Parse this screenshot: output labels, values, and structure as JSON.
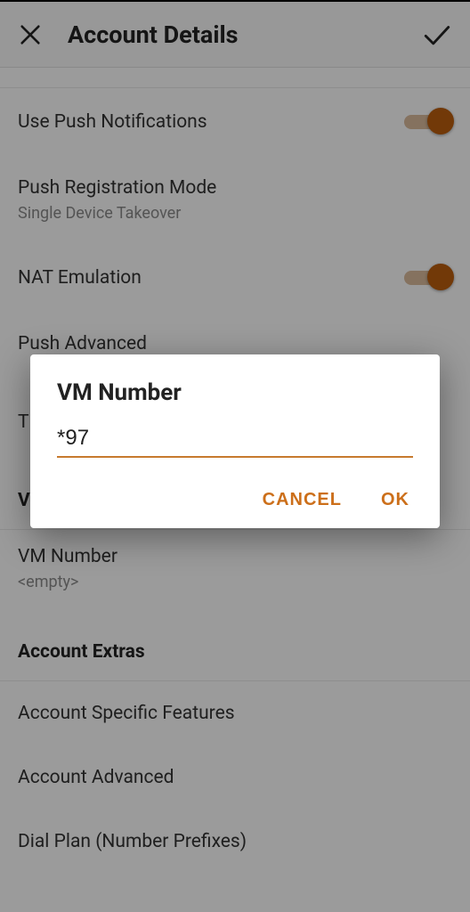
{
  "header": {
    "title": "Account Details"
  },
  "rows": {
    "push_notifications": {
      "label": "Use Push Notifications"
    },
    "push_reg_mode": {
      "label": "Push Registration Mode",
      "value": "Single Device Takeover"
    },
    "nat_emulation": {
      "label": "NAT Emulation"
    },
    "push_advanced": {
      "label": "Push Advanced"
    },
    "t_row": {
      "label": "T"
    },
    "vo_header": "Vo",
    "vm_number": {
      "label": "VM Number",
      "value": "<empty>"
    },
    "account_extras": "Account Extras",
    "account_specific": {
      "label": "Account Specific Features"
    },
    "account_advanced": {
      "label": "Account Advanced"
    },
    "dial_plan": {
      "label": "Dial Plan (Number Prefixes)"
    }
  },
  "dialog": {
    "title": "VM Number",
    "value": "*97",
    "cancel": "CANCEL",
    "ok": "OK"
  },
  "colors": {
    "accent": "#cc6f1a"
  }
}
